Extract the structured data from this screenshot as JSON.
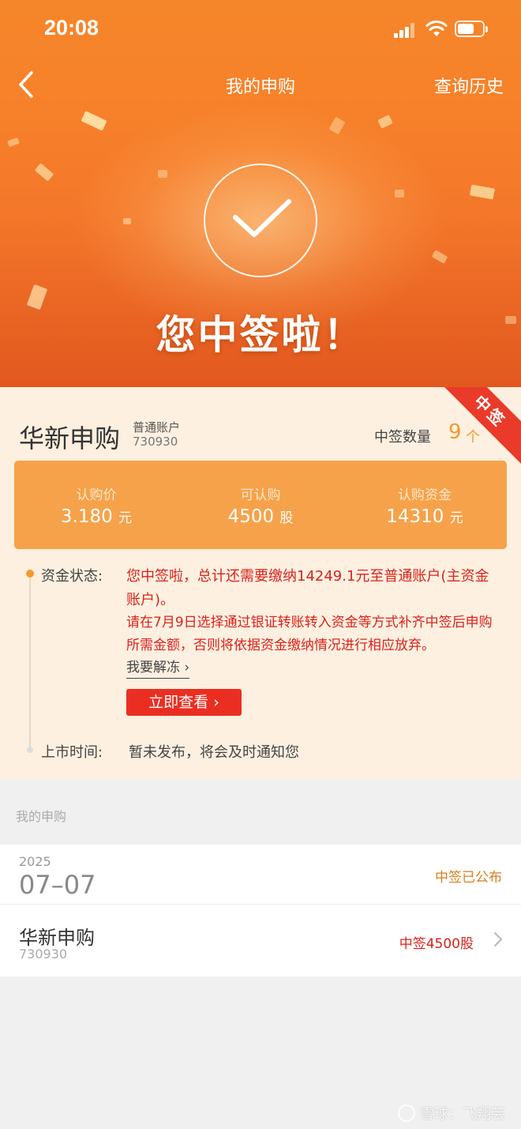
{
  "status_bar": {
    "time": "20:08"
  },
  "nav": {
    "title": "我的申购",
    "history_label": "查询历史"
  },
  "banner": {
    "headline": "您中签啦！",
    "icon": "check-circle-icon"
  },
  "result": {
    "ribbon": "中签",
    "stock_name": "华新申购",
    "account_type": "普通账户",
    "stock_code": "730930",
    "qty_label": "中签数量",
    "qty_value": "9",
    "qty_unit": "个",
    "stats": [
      {
        "label": "认购价",
        "value": "3.180",
        "unit": "元"
      },
      {
        "label": "可认购",
        "value": "4500",
        "unit": "股"
      },
      {
        "label": "认购资金",
        "value": "14310",
        "unit": "元"
      }
    ],
    "fund_status_label": "资金状态:",
    "fund_status_msg1": "您中签啦，总计还需要缴纳14249.1元至普通账户(主资金账户)。",
    "fund_status_msg2": "请在7月9日选择通过银证转账转入资金等方式补齐中签后申购所需金额，否则将依据资金缴纳情况进行相应放弃。",
    "unfreeze_link": "我要解冻",
    "view_button": "立即查看",
    "listing_label": "上市时间:",
    "listing_value": "暂未发布，将会及时通知您"
  },
  "my_subscriptions": {
    "section_title": "我的申购",
    "year": "2025",
    "date": "07–07",
    "status": "中签已公布",
    "item": {
      "name": "华新申购",
      "code": "730930",
      "result": "中签4500股"
    }
  },
  "watermark": "雪球：飞翔芸",
  "colors": {
    "header_orange": "#f5862a",
    "card_bg": "#fef0e0",
    "stats_bg": "#f6a24a",
    "alert_red": "#d9231c",
    "button_red": "#ea2f22",
    "accent_orange": "#f39a2d"
  }
}
